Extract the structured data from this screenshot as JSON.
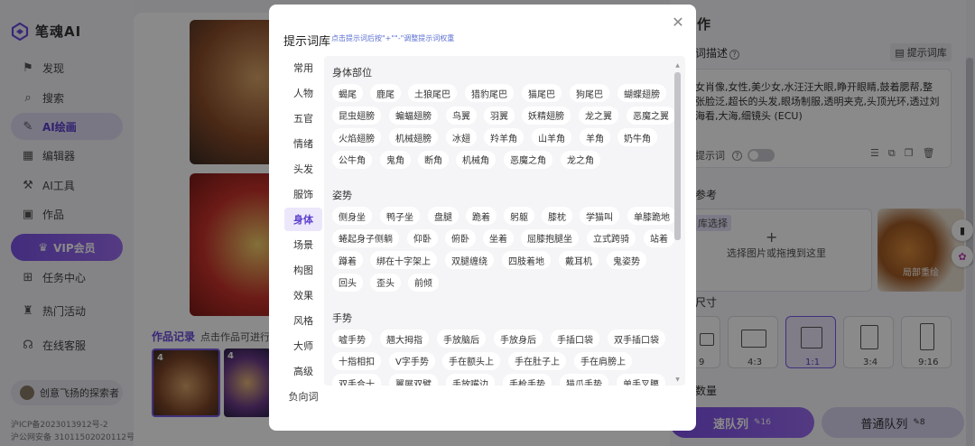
{
  "brand": {
    "name": "笔魂AI",
    "accent": "#6a4bdc"
  },
  "sidebar": {
    "items": [
      {
        "label": "发现",
        "icon": "flag-icon"
      },
      {
        "label": "搜索",
        "icon": "search-icon"
      },
      {
        "label": "AI绘画",
        "icon": "paint-icon",
        "active": true
      },
      {
        "label": "编辑器",
        "icon": "editor-icon"
      },
      {
        "label": "AI工具",
        "icon": "tool-icon"
      },
      {
        "label": "作品",
        "icon": "image-icon"
      }
    ],
    "vip": "VIP会员",
    "items2": [
      {
        "label": "任务中心",
        "icon": "gift-icon"
      },
      {
        "label": "热门活动",
        "icon": "trophy-icon"
      },
      {
        "label": "在线客服",
        "icon": "headset-icon"
      }
    ],
    "user": "创意飞扬的探索者",
    "icp1": "沪ICP备2023013912号-2",
    "icp2": "沪公网安备 31011502020112号"
  },
  "main": {
    "records_title": "作品记录",
    "records_tip": "点击作品可进行二",
    "thumb_count": "4"
  },
  "right": {
    "title": "作",
    "prompt_label": "词描述",
    "prompt_lib_btn": "提示词库",
    "prompt_text": "女肖像,女性,美少女,水汪汪大眼,睁开眼睛,鼓着腮帮,整张脸泛,超长的头发,眼场制服,透明夹克,头顶光环,透过刘海看,大海,细镜头 (ECU)",
    "neg_label": "提示词",
    "ref_label": "参考",
    "lib_chip": "库选择",
    "upload_tip": "选择图片或拖拽到这里",
    "ref_card_label": "局部重绘",
    "size_label": "尺寸",
    "ratios": [
      "9",
      "4:3",
      "1:1",
      "3:4",
      "9:16"
    ],
    "qty_label": "数量",
    "fast_queue": "速队列",
    "fast_count": "16",
    "normal_queue": "普通队列",
    "normal_count": "8"
  },
  "modal": {
    "title": "提示词库",
    "subtitle": "点击提示词后按\"+\"\"-\"调整提示词权重",
    "categories": [
      "常用",
      "人物",
      "五官",
      "情绪",
      "头发",
      "服饰",
      "身体",
      "场景",
      "构图",
      "效果",
      "风格",
      "大师",
      "高级",
      "负向词"
    ],
    "active_category": "身体",
    "sections": [
      {
        "title": "身体部位",
        "rows": [
          [
            "蝎尾",
            "鹿尾",
            "土狼尾巴",
            "猎豹尾巴",
            "猫尾巴",
            "狗尾巴",
            "蝴蝶翅膀"
          ],
          [
            "昆虫翅膀",
            "蝙蝠翅膀",
            "鸟翼",
            "羽翼",
            "妖精翅膀",
            "龙之翼",
            "恶魔之翼"
          ],
          [
            "火焰翅膀",
            "机械翅膀",
            "冰翅",
            "羚羊角",
            "山羊角",
            "羊角",
            "奶牛角"
          ],
          [
            "公牛角",
            "鬼角",
            "断角",
            "机械角",
            "恶魔之角",
            "龙之角"
          ]
        ]
      },
      {
        "title": "姿势",
        "rows": [
          [
            "侧身坐",
            "鸭子坐",
            "盘腿",
            "跪着",
            "躬躯",
            "膝枕",
            "学猫叫",
            "单膝跪地"
          ],
          [
            "蜷起身子侧躺",
            "仰卧",
            "俯卧",
            "坐着",
            "屈膝抱腿坐",
            "立式跨骑",
            "站着"
          ],
          [
            "蹲着",
            "绑在十字架上",
            "双腿缠绕",
            "四肢着地",
            "戴耳机",
            "鬼姿势"
          ],
          [
            "回头",
            "歪头",
            "前倾"
          ]
        ]
      },
      {
        "title": "手势",
        "rows": [
          [
            "嘘手势",
            "翘大拇指",
            "手放脑后",
            "手放身后",
            "手插口袋",
            "双手插口袋"
          ],
          [
            "十指相扣",
            "V字手势",
            "手在额头上",
            "手在肚子上",
            "手在肩膀上"
          ],
          [
            "双手合十",
            "翼展双臂",
            "手放嘴边",
            "手枪手势",
            "猫爪手势",
            "单手叉腰"
          ]
        ]
      }
    ]
  }
}
